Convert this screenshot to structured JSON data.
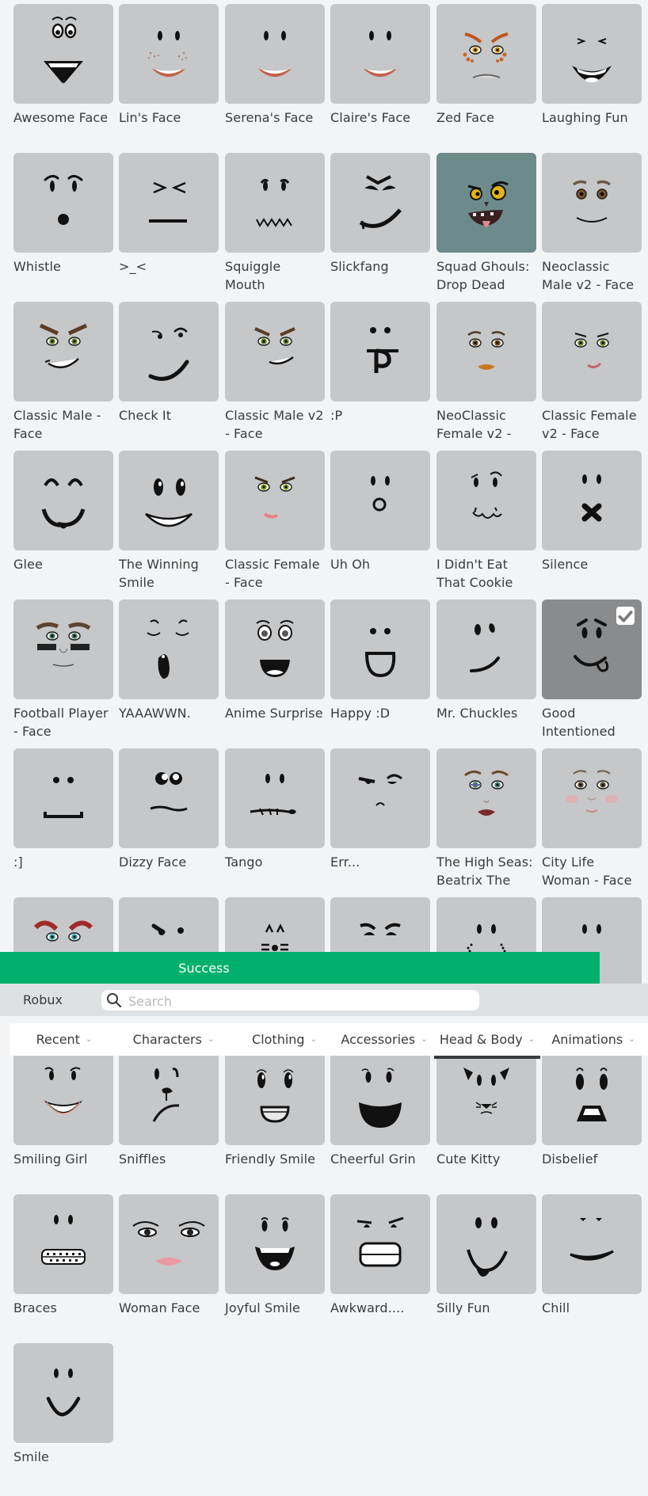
{
  "success_banner": {
    "text": "Success",
    "color": "#02b06d"
  },
  "toolbar": {
    "robux_label": "Robux",
    "search_placeholder": "Search",
    "search_value": ""
  },
  "tabs": [
    {
      "label": "Recent",
      "active": false
    },
    {
      "label": "Characters",
      "active": false
    },
    {
      "label": "Clothing",
      "active": false
    },
    {
      "label": "Accessories",
      "active": false
    },
    {
      "label": "Head & Body",
      "active": true
    },
    {
      "label": "Animations",
      "active": false
    }
  ],
  "items_above": [
    {
      "name": "Awesome Face",
      "face": "awesome"
    },
    {
      "name": "Lin's Face",
      "face": "lin"
    },
    {
      "name": "Serena's Face",
      "face": "serena"
    },
    {
      "name": "Claire's Face",
      "face": "claire"
    },
    {
      "name": "Zed Face",
      "face": "zed"
    },
    {
      "name": "Laughing Fun",
      "face": "laughing"
    },
    {
      "name": "Whistle",
      "face": "whistle"
    },
    {
      "name": ">_<",
      "face": "squint"
    },
    {
      "name": "Squiggle Mouth",
      "face": "squiggle"
    },
    {
      "name": "Slickfang",
      "face": "slickfang"
    },
    {
      "name": "Squad Ghouls: Drop Dead",
      "face": "ghoul"
    },
    {
      "name": "Neoclassic Male v2 - Face",
      "face": "neomale"
    },
    {
      "name": "Classic Male - Face",
      "face": "classicmale"
    },
    {
      "name": "Check It",
      "face": "checkit"
    },
    {
      "name": "Classic Male v2 - Face",
      "face": "classicmale2"
    },
    {
      "name": ":P",
      "face": "tongue"
    },
    {
      "name": "NeoClassic Female v2 -",
      "face": "neofemale"
    },
    {
      "name": "Classic Female v2 - Face",
      "face": "classicfemale2"
    },
    {
      "name": "Glee",
      "face": "glee"
    },
    {
      "name": "The Winning Smile",
      "face": "winning"
    },
    {
      "name": "Classic Female - Face",
      "face": "classicfemale"
    },
    {
      "name": "Uh Oh",
      "face": "uhoh"
    },
    {
      "name": "I Didn't Eat That Cookie",
      "face": "cookie"
    },
    {
      "name": "Silence",
      "face": "silence"
    },
    {
      "name": "Football Player - Face",
      "face": "football"
    },
    {
      "name": "YAAAWWN.",
      "face": "yawn"
    },
    {
      "name": "Anime Surprise",
      "face": "anime"
    },
    {
      "name": "Happy :D",
      "face": "happyd"
    },
    {
      "name": "Mr. Chuckles",
      "face": "chuckles"
    },
    {
      "name": "Good Intentioned",
      "face": "goodint",
      "selected": true
    },
    {
      "name": ":]",
      "face": "bracket"
    },
    {
      "name": "Dizzy Face",
      "face": "dizzy"
    },
    {
      "name": "Tango",
      "face": "tango"
    },
    {
      "name": "Err...",
      "face": "err"
    },
    {
      "name": "The High Seas: Beatrix The",
      "face": "beatrix"
    },
    {
      "name": "City Life Woman - Face",
      "face": "citywoman"
    }
  ],
  "items_partial": [
    {
      "face": "angryred"
    },
    {
      "face": "wink"
    },
    {
      "face": "kitty2"
    },
    {
      "face": "grumpy"
    },
    {
      "face": "dots"
    },
    {
      "face": "plain"
    }
  ],
  "items_below": [
    {
      "name": "Smiling Girl",
      "face": "smilinggirl"
    },
    {
      "name": "Sniffles",
      "face": "sniffles"
    },
    {
      "name": "Friendly Smile",
      "face": "friendly"
    },
    {
      "name": "Cheerful Grin",
      "face": "cheerful"
    },
    {
      "name": "Cute Kitty",
      "face": "cutekitty"
    },
    {
      "name": "Disbelief",
      "face": "disbelief"
    },
    {
      "name": "Braces",
      "face": "braces"
    },
    {
      "name": "Woman Face",
      "face": "woman"
    },
    {
      "name": "Joyful Smile",
      "face": "joyful"
    },
    {
      "name": "Awkward....",
      "face": "awkward"
    },
    {
      "name": "Silly Fun",
      "face": "silly"
    },
    {
      "name": "Chill",
      "face": "chill"
    },
    {
      "name": "Smile",
      "face": "smile"
    }
  ]
}
